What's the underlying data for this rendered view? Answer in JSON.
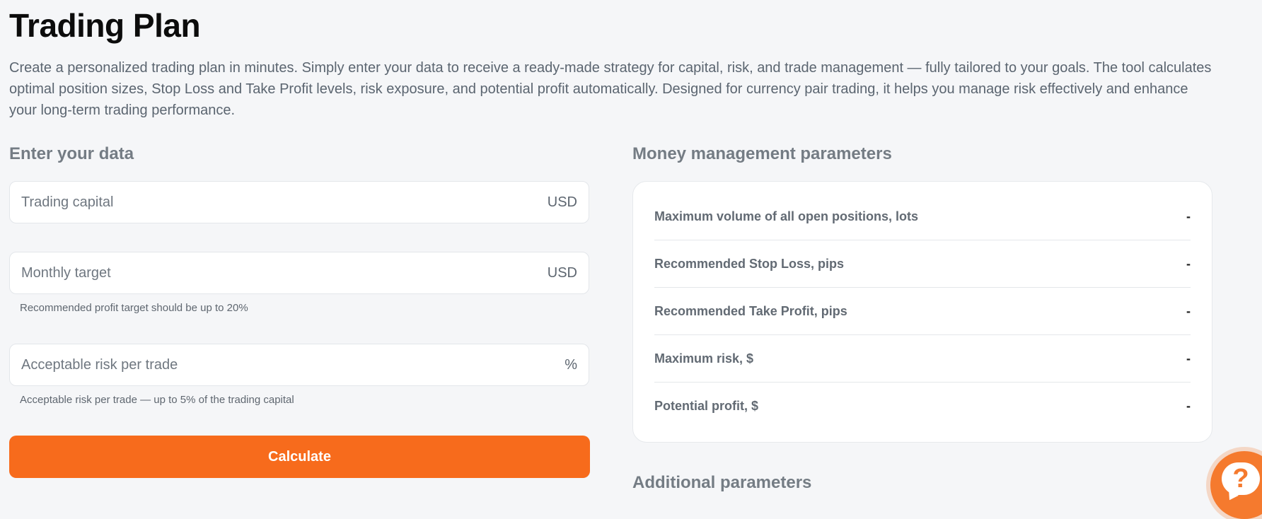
{
  "page": {
    "title": "Trading Plan",
    "intro": "Create a personalized trading plan in minutes. Simply enter your data to receive a ready-made strategy for capital, risk, and trade management — fully tailored to your goals. The tool calculates optimal position sizes, Stop Loss and Take Profit levels, risk exposure, and potential profit automatically. Designed for currency pair trading, it helps you manage risk effectively and enhance your long-term trading performance."
  },
  "form": {
    "heading": "Enter your data",
    "fields": [
      {
        "placeholder": "Trading capital",
        "value": "",
        "unit": "USD",
        "hint": ""
      },
      {
        "placeholder": "Monthly target",
        "value": "",
        "unit": "USD",
        "hint": "Recommended profit target should be up to 20%"
      },
      {
        "placeholder": "Acceptable risk per trade",
        "value": "",
        "unit": "%",
        "hint": "Acceptable risk per trade — up to 5% of the trading capital"
      }
    ],
    "submit_label": "Calculate"
  },
  "money_management": {
    "heading": "Money management parameters",
    "rows": [
      {
        "label": "Maximum volume of all open positions, lots",
        "value": "-"
      },
      {
        "label": "Recommended Stop Loss, pips",
        "value": "-"
      },
      {
        "label": "Recommended Take Profit, pips",
        "value": "-"
      },
      {
        "label": "Maximum risk, $",
        "value": "-"
      },
      {
        "label": "Potential profit, $",
        "value": "-"
      }
    ]
  },
  "additional": {
    "heading": "Additional parameters"
  },
  "help": {
    "icon": "question-chat-icon",
    "glyph": "?"
  },
  "colors": {
    "accent": "#f76b1c",
    "background": "#f5f6f8",
    "card": "#ffffff"
  }
}
